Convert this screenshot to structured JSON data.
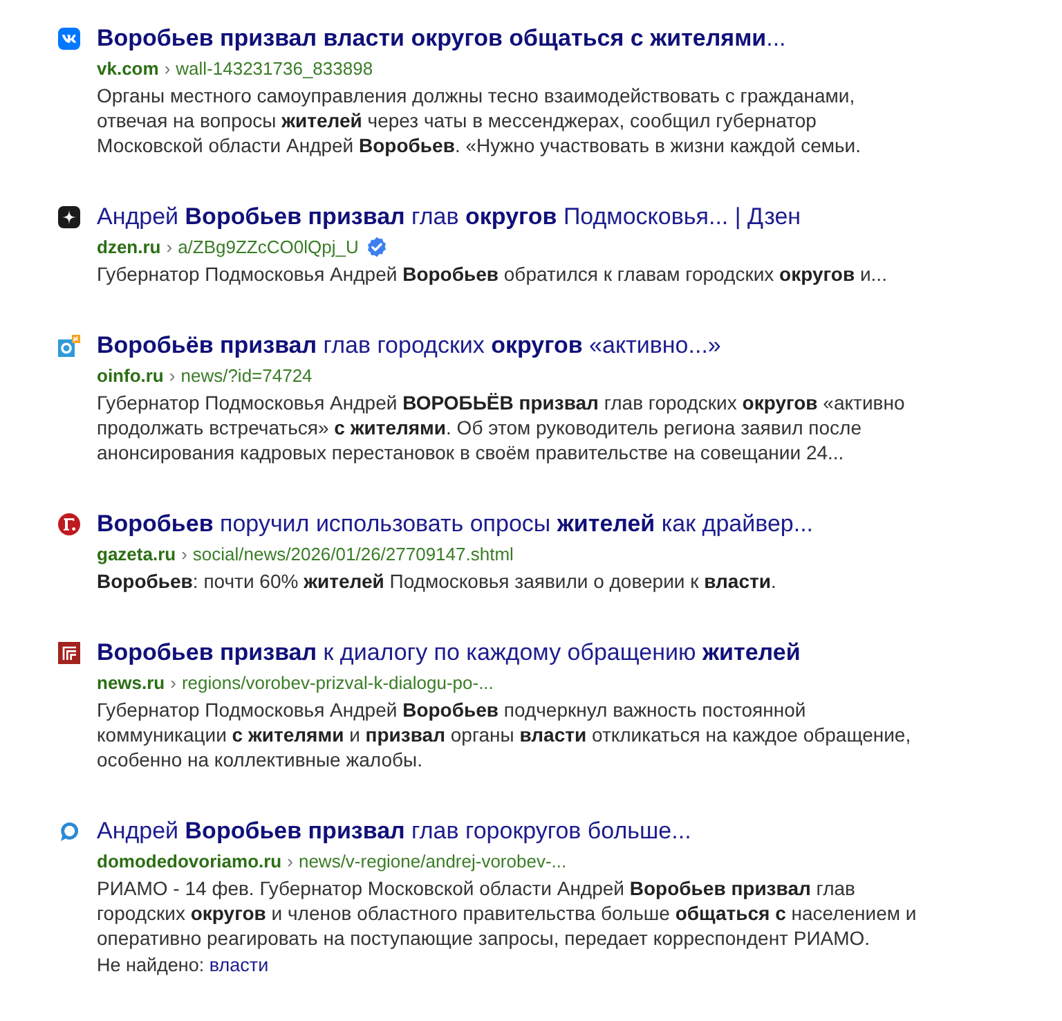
{
  "results": [
    {
      "title": "**Воробьев призвал власти округов общаться с жителями**...",
      "domain": "vk.com",
      "separator": "›",
      "path": "wall-143231736_833898",
      "verified": false,
      "snippet": "Органы местного самоуправления должны тесно взаимодействовать с гражданами, отвечая на вопросы **жителей** через чаты в мессенджерах, сообщил губернатор Московской области Андрей **Воробьев**. «Нужно участвовать в жизни каждой семьи."
    },
    {
      "title": "Андрей **Воробьев призвал** глав **округов** Подмосковья... | Дзен",
      "domain": "dzen.ru",
      "separator": "›",
      "path": "a/ZBg9ZZcCO0lQpj_U",
      "verified": true,
      "snippet": "Губернатор Подмосковья Андрей **Воробьев** обратился к главам городских **округов** и..."
    },
    {
      "title": "**Воробьёв призвал** глав городских **округов** «активно...»",
      "domain": "oinfo.ru",
      "separator": "›",
      "path": "news/?id=74724",
      "verified": false,
      "snippet": "Губернатор Подмосковья Андрей **ВОРОБЬЁВ призвал** глав городских **округов** «активно продолжать встречаться» **с жителями**. Об этом руководитель региона заявил после анонсирования кадровых перестановок в своём правительстве на совещании 24..."
    },
    {
      "title": "**Воробьев** поручил использовать опросы **жителей** как драйвер...",
      "domain": "gazeta.ru",
      "separator": "›",
      "path": "social/news/2026/01/26/27709147.shtml",
      "verified": false,
      "snippet": "**Воробьев**: почти 60% **жителей** Подмосковья заявили о доверии к **власти**."
    },
    {
      "title": "**Воробьев призвал** к диалогу по каждому обращению **жителей**",
      "domain": "news.ru",
      "separator": "›",
      "path": "regions/vorobev-prizval-k-dialogu-po-...",
      "verified": false,
      "snippet": "Губернатор Подмосковья Андрей **Воробьев** подчеркнул важность постоянной коммуникации **с жителями** и **призвал** органы **власти** откликаться на каждое обращение, особенно на коллективные жалобы."
    },
    {
      "title": "Андрей **Воробьев призвал** глав горокругов больше...",
      "domain": "domodedovoriamo.ru",
      "separator": "›",
      "path": "news/v-regione/andrej-vorobev-...",
      "verified": false,
      "snippet": "РИАМО - 14 фев. Губернатор Московской области Андрей **Воробьев призвал** глав городских **округов** и членов областного правительства больше **общаться с** населением и оперативно реагировать на поступающие запросы, передает корреспондент РИАМО.",
      "not_found": {
        "label": "Не найдено:",
        "term": "власти"
      }
    }
  ]
}
